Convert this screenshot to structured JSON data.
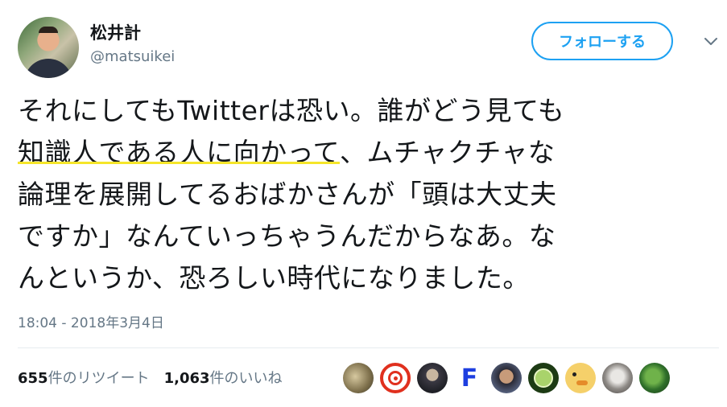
{
  "user": {
    "name": "松井計",
    "handle": "@matsuikei"
  },
  "follow_button": {
    "label": "フォローする"
  },
  "tweet": {
    "lines": [
      "それにしてもTwitterは恐い。誰がどう見ても",
      [
        "知識人である人に向かって",
        "、ムチャクチャな"
      ],
      "論理を展開してるおばかさんが「頭は大丈夫",
      "ですか」なんていっちゃうんだからなあ。な",
      "んというか、恐ろしい時代になりました。"
    ],
    "highlight_color": "#f5e52a"
  },
  "timestamp": "18:04 - 2018年3月4日",
  "stats": {
    "retweets_count": "655",
    "retweets_label": "件のリツイート",
    "likes_count": "1,063",
    "likes_label": "件のいいね"
  },
  "likers": [
    "avatar",
    "avatar",
    "avatar",
    "F",
    "avatar",
    "avatar",
    "avatar",
    "avatar",
    "avatar"
  ],
  "colors": {
    "accent": "#1da1f2",
    "text": "#14171a",
    "muted": "#657786",
    "divider": "#e6ecf0"
  },
  "icons": {
    "caret": "chevron-down-icon"
  }
}
